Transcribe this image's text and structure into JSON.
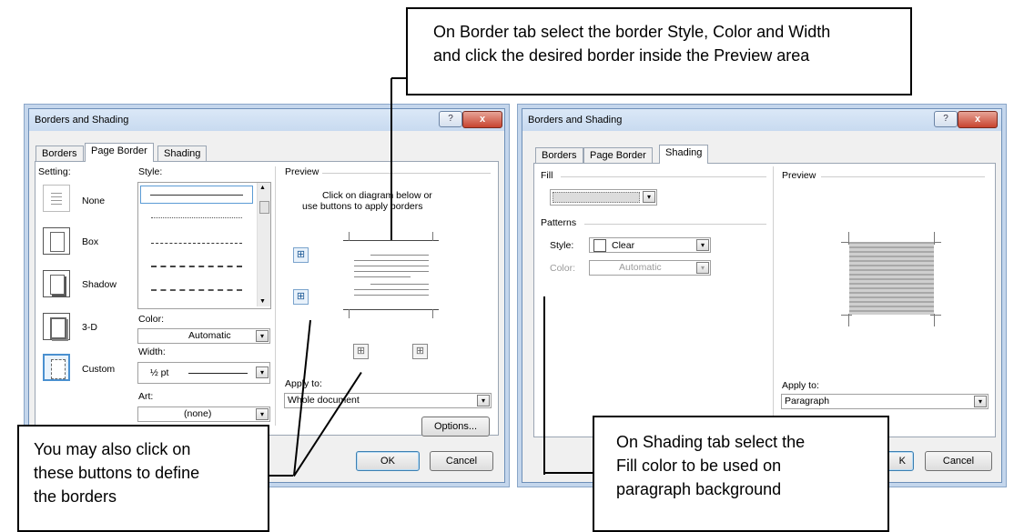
{
  "callouts": {
    "top_line1": "On Border tab select the border Style, Color and Width",
    "top_line2": "and click the desired border inside the Preview area",
    "bottom_left_line1": "You may also click on",
    "bottom_left_line2": "these buttons to define",
    "bottom_left_line3": "the borders",
    "bottom_right_line1": "On Shading tab select the",
    "bottom_right_line2": "Fill color to be used on",
    "bottom_right_line3": "paragraph background"
  },
  "left_dialog": {
    "title": "Borders and Shading",
    "help_glyph": "?",
    "close_glyph": "x",
    "tabs": [
      "Borders",
      "Page Border",
      "Shading"
    ],
    "setting_label": "Setting:",
    "settings": [
      "None",
      "Box",
      "Shadow",
      "3-D",
      "Custom"
    ],
    "style_label": "Style:",
    "color_label": "Color:",
    "color_value": "Automatic",
    "width_label": "Width:",
    "width_value": "½ pt",
    "art_label": "Art:",
    "art_value": "(none)",
    "preview_label": "Preview",
    "preview_hint1": "Click on diagram below or",
    "preview_hint2": "use buttons to apply borders",
    "apply_to_label": "Apply to:",
    "apply_to_value": "Whole document",
    "options_button": "Options...",
    "ok_button": "OK",
    "cancel_button": "Cancel"
  },
  "right_dialog": {
    "title": "Borders and Shading",
    "help_glyph": "?",
    "close_glyph": "x",
    "tabs": [
      "Borders",
      "Page Border",
      "Shading"
    ],
    "fill_label": "Fill",
    "patterns_label": "Patterns",
    "style_label": "Style:",
    "style_value": "Clear",
    "color_label": "Color:",
    "color_value": "Automatic",
    "preview_label": "Preview",
    "apply_to_label": "Apply to:",
    "apply_to_value": "Paragraph",
    "ok_fragment": "K",
    "cancel_button": "Cancel"
  },
  "icons": {
    "dropdown": "▾"
  }
}
